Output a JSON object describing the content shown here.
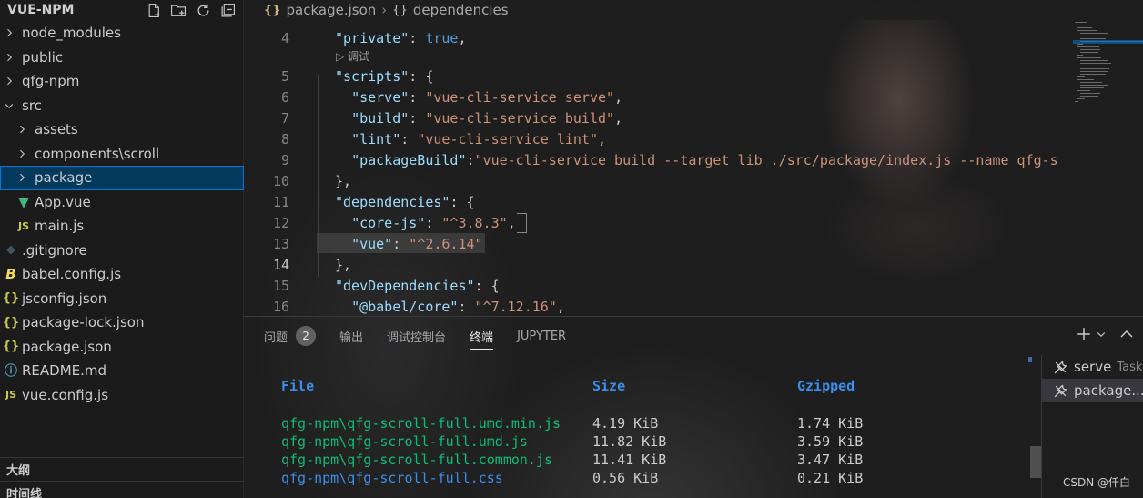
{
  "sidebar": {
    "title": "VUE-NPM",
    "tree": [
      {
        "label": "node_modules",
        "kind": "folder",
        "depth": 0,
        "open": false
      },
      {
        "label": "public",
        "kind": "folder",
        "depth": 0,
        "open": false
      },
      {
        "label": "qfg-npm",
        "kind": "folder",
        "depth": 0,
        "open": false
      },
      {
        "label": "src",
        "kind": "folder",
        "depth": 0,
        "open": true
      },
      {
        "label": "assets",
        "kind": "folder",
        "depth": 1,
        "open": false
      },
      {
        "label": "components\\scroll",
        "kind": "folder",
        "depth": 1,
        "open": false
      },
      {
        "label": "package",
        "kind": "folder",
        "depth": 1,
        "open": false,
        "selected": true
      },
      {
        "label": "App.vue",
        "kind": "vue",
        "depth": 1
      },
      {
        "label": "main.js",
        "kind": "js",
        "depth": 1
      },
      {
        "label": ".gitignore",
        "kind": "git",
        "depth": 0
      },
      {
        "label": "babel.config.js",
        "kind": "babel",
        "depth": 0
      },
      {
        "label": "jsconfig.json",
        "kind": "json",
        "depth": 0
      },
      {
        "label": "package-lock.json",
        "kind": "json",
        "depth": 0
      },
      {
        "label": "package.json",
        "kind": "json",
        "depth": 0
      },
      {
        "label": "README.md",
        "kind": "info",
        "depth": 0
      },
      {
        "label": "vue.config.js",
        "kind": "js",
        "depth": 0
      }
    ],
    "outline_label": "大纲",
    "timeline_label": "时间线"
  },
  "breadcrumb": {
    "file_icon": "{}",
    "file": "package.json",
    "node_icon": "{}",
    "node": "dependencies"
  },
  "editor": {
    "active_line": 14,
    "codelens": "调试",
    "lines": [
      {
        "num": "4",
        "segments": [
          [
            "k",
            "\"private\""
          ],
          [
            "p",
            ": "
          ],
          [
            "b",
            "true"
          ],
          [
            "p",
            ","
          ]
        ]
      },
      {
        "num": "5",
        "segments": [
          [
            "k",
            "\"scripts\""
          ],
          [
            "p",
            ": {"
          ]
        ]
      },
      {
        "num": "6",
        "segments": [
          [
            "p",
            "  "
          ],
          [
            "k",
            "\"serve\""
          ],
          [
            "p",
            ": "
          ],
          [
            "s",
            "\"vue-cli-service serve\""
          ],
          [
            "p",
            ","
          ]
        ]
      },
      {
        "num": "7",
        "segments": [
          [
            "p",
            "  "
          ],
          [
            "k",
            "\"build\""
          ],
          [
            "p",
            ": "
          ],
          [
            "s",
            "\"vue-cli-service build\""
          ],
          [
            "p",
            ","
          ]
        ]
      },
      {
        "num": "8",
        "segments": [
          [
            "p",
            "  "
          ],
          [
            "k",
            "\"lint\""
          ],
          [
            "p",
            ": "
          ],
          [
            "s",
            "\"vue-cli-service lint\""
          ],
          [
            "p",
            ","
          ]
        ]
      },
      {
        "num": "9",
        "segments": [
          [
            "p",
            "  "
          ],
          [
            "k",
            "\"packageBuild\""
          ],
          [
            "p",
            ":"
          ],
          [
            "s",
            "\"vue-cli-service build --target lib ./src/package/index.js --name qfg-s"
          ]
        ]
      },
      {
        "num": "10",
        "segments": [
          [
            "p",
            "},"
          ]
        ]
      },
      {
        "num": "11",
        "segments": [
          [
            "k",
            "\"dependencies\""
          ],
          [
            "p",
            ": {"
          ]
        ]
      },
      {
        "num": "12",
        "segments": [
          [
            "p",
            "  "
          ],
          [
            "k",
            "\"core-js\""
          ],
          [
            "p",
            ": "
          ],
          [
            "s",
            "\"^3.8.3\""
          ],
          [
            "p",
            ","
          ]
        ]
      },
      {
        "num": "13",
        "segments": [
          [
            "p",
            "  "
          ],
          [
            "k",
            "\"vue\""
          ],
          [
            "p",
            ": "
          ],
          [
            "s",
            "\"^2.6.14\""
          ]
        ]
      },
      {
        "num": "14",
        "segments": [
          [
            "p",
            "},"
          ]
        ]
      },
      {
        "num": "15",
        "segments": [
          [
            "k",
            "\"devDependencies\""
          ],
          [
            "p",
            ": {"
          ]
        ]
      },
      {
        "num": "16",
        "segments": [
          [
            "p",
            "  "
          ],
          [
            "k",
            "\"@babel/core\""
          ],
          [
            "p",
            ": "
          ],
          [
            "s",
            "\"^7.12.16\""
          ],
          [
            "p",
            ","
          ]
        ]
      }
    ]
  },
  "panel": {
    "tabs": [
      {
        "label": "问题",
        "badge": "2"
      },
      {
        "label": "输出"
      },
      {
        "label": "调试控制台"
      },
      {
        "label": "终端",
        "active": true
      },
      {
        "label": "JUPYTER"
      }
    ],
    "terminal": {
      "headers": [
        "File",
        "Size",
        "Gzipped"
      ],
      "rows": [
        {
          "file": "qfg-npm\\qfg-scroll-full.umd.min.js",
          "size": "4.19 KiB",
          "gzip": "1.74 KiB",
          "color": "green"
        },
        {
          "file": "qfg-npm\\qfg-scroll-full.umd.js",
          "size": "11.82 KiB",
          "gzip": "3.59 KiB",
          "color": "green"
        },
        {
          "file": "qfg-npm\\qfg-scroll-full.common.js",
          "size": "11.41 KiB",
          "gzip": "3.47 KiB",
          "color": "green"
        },
        {
          "file": "qfg-npm\\qfg-scroll-full.css",
          "size": "0.56 KiB",
          "gzip": "0.21 KiB",
          "color": "blue"
        }
      ]
    },
    "terminal_list": [
      {
        "label": "serve",
        "sub": "Task"
      },
      {
        "label": "package...",
        "sub": "",
        "selected": true
      }
    ]
  },
  "watermark": "CSDN @仟白",
  "colors": {
    "accent": "#0078d4",
    "selection_bg": "#04395e",
    "json_key": "#9cdcfe",
    "json_string": "#ce9178",
    "terminal_green": "#23d18b",
    "terminal_blue": "#3b8eea"
  }
}
